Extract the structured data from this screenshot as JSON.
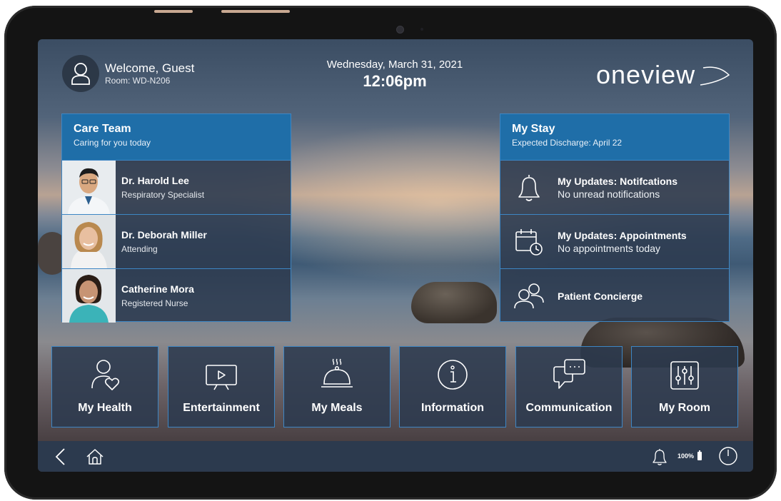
{
  "header": {
    "welcome": "Welcome, Guest",
    "room": "Room: WD-N206",
    "date": "Wednesday, March 31, 2021",
    "time": "12:06pm",
    "logo_text": "oneview"
  },
  "care_team": {
    "title": "Care Team",
    "subtitle": "Caring for you today",
    "members": [
      {
        "name": "Dr. Harold Lee",
        "role": "Respiratory Specialist"
      },
      {
        "name": "Dr. Deborah Miller",
        "role": "Attending"
      },
      {
        "name": "Catherine Mora",
        "role": "Registered Nurse"
      }
    ]
  },
  "my_stay": {
    "title": "My Stay",
    "subtitle": "Expected Discharge: April 22",
    "items": [
      {
        "title": "My Updates: Notifcations",
        "subtitle": "No unread notifications",
        "icon": "bell-icon"
      },
      {
        "title": "My Updates: Appointments",
        "subtitle": "No appointments today",
        "icon": "calendar-clock-icon"
      },
      {
        "title": "Patient Concierge",
        "subtitle": "",
        "icon": "people-icon"
      }
    ]
  },
  "tiles": [
    {
      "label": "My Health",
      "icon": "heart-person-icon"
    },
    {
      "label": "Entertainment",
      "icon": "tv-icon"
    },
    {
      "label": "My Meals",
      "icon": "cloche-icon"
    },
    {
      "label": "Information",
      "icon": "info-icon"
    },
    {
      "label": "Communication",
      "icon": "chat-icon"
    },
    {
      "label": "My Room",
      "icon": "sliders-icon"
    }
  ],
  "navbar": {
    "battery": "100%"
  },
  "colors": {
    "panel_header": "#1f6ea8",
    "panel_body": "#2c3a4e",
    "panel_border": "#3d86c4"
  }
}
